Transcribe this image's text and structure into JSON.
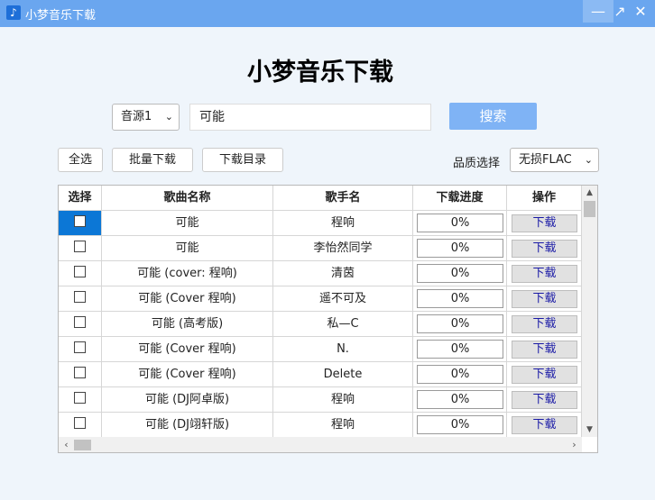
{
  "window": {
    "title": "小梦音乐下载",
    "app_icon": "music-note-icon",
    "minimize_symbol": "—",
    "maximize_symbol": "↗",
    "close_symbol": "✕"
  },
  "main": {
    "heading": "小梦音乐下载"
  },
  "search": {
    "source_value": "音源1",
    "query": "可能",
    "button": "搜索"
  },
  "toolbar": {
    "select_all": "全选",
    "batch_download": "批量下载",
    "download_dir": "下载目录",
    "quality_label": "品质选择",
    "quality_value": "无损FLAC"
  },
  "table": {
    "headers": {
      "select": "选择",
      "song": "歌曲名称",
      "artist": "歌手名",
      "progress": "下载进度",
      "action": "操作"
    },
    "rows": [
      {
        "song": "可能",
        "artist": "程响",
        "progress": "0%",
        "action": "下载"
      },
      {
        "song": "可能",
        "artist": "李怡然同学",
        "progress": "0%",
        "action": "下载"
      },
      {
        "song": "可能 (cover: 程响)",
        "artist": "清茵",
        "progress": "0%",
        "action": "下载"
      },
      {
        "song": "可能 (Cover 程响)",
        "artist": "遥不可及",
        "progress": "0%",
        "action": "下载"
      },
      {
        "song": "可能 (高考版)",
        "artist": "私—C",
        "progress": "0%",
        "action": "下载"
      },
      {
        "song": "可能 (Cover 程响)",
        "artist": "N.",
        "progress": "0%",
        "action": "下载"
      },
      {
        "song": "可能 (Cover 程响)",
        "artist": "Delete",
        "progress": "0%",
        "action": "下载"
      },
      {
        "song": "可能 (DJ阿卓版)",
        "artist": "程响",
        "progress": "0%",
        "action": "下载"
      },
      {
        "song": "可能 (DJ翊轩版)",
        "artist": "程响",
        "progress": "0%",
        "action": "下载"
      }
    ]
  },
  "colors": {
    "titlebar": "#6aa6ef",
    "accent": "#7fb3f5",
    "selection": "#0c77d6"
  }
}
